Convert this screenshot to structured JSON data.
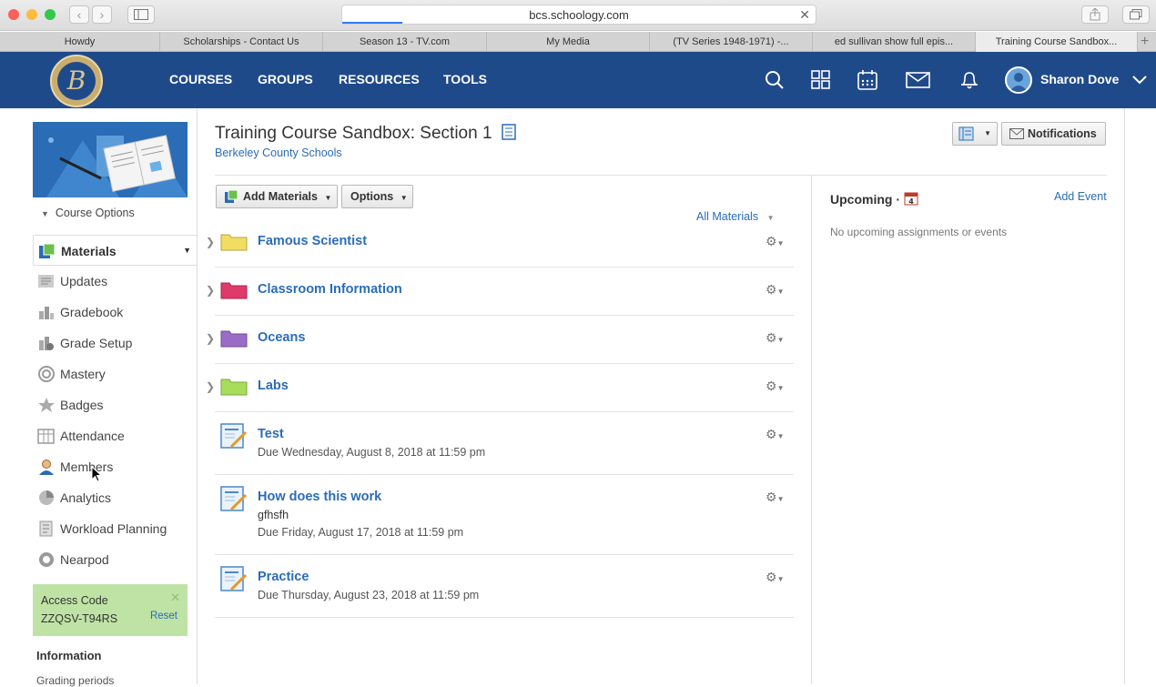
{
  "browser": {
    "url": "bcs.schoology.com",
    "tabs": [
      "Howdy",
      "Scholarships - Contact Us",
      "Season 13 - TV.com",
      "My Media",
      "(TV Series 1948-1971) -...",
      "ed sullivan show full epis...",
      "Training Course Sandbox..."
    ],
    "active_tab": 6
  },
  "nav": {
    "logo_letter": "B",
    "links": [
      "COURSES",
      "GROUPS",
      "RESOURCES",
      "TOOLS"
    ],
    "user_name": "Sharon Dove"
  },
  "sidebar": {
    "course_options": "Course Options",
    "items": [
      {
        "label": "Materials",
        "icon": "materials-icon"
      },
      {
        "label": "Updates",
        "icon": "updates-icon"
      },
      {
        "label": "Gradebook",
        "icon": "gradebook-icon"
      },
      {
        "label": "Grade Setup",
        "icon": "grade-setup-icon"
      },
      {
        "label": "Mastery",
        "icon": "mastery-icon"
      },
      {
        "label": "Badges",
        "icon": "badges-icon"
      },
      {
        "label": "Attendance",
        "icon": "attendance-icon"
      },
      {
        "label": "Members",
        "icon": "members-icon"
      },
      {
        "label": "Analytics",
        "icon": "analytics-icon"
      },
      {
        "label": "Workload Planning",
        "icon": "workload-icon"
      },
      {
        "label": "Nearpod",
        "icon": "nearpod-icon"
      }
    ],
    "access_code_label": "Access Code",
    "access_code": "ZZQSV-T94RS",
    "reset": "Reset",
    "info_heading": "Information",
    "grading_periods": "Grading periods"
  },
  "course": {
    "title": "Training Course Sandbox: Section 1",
    "school": "Berkeley County Schools",
    "notifications": "Notifications",
    "add_materials": "Add Materials",
    "options": "Options",
    "all_materials": "All Materials"
  },
  "materials": [
    {
      "type": "folder",
      "title": "Famous Scientist",
      "color": "#f2dd63"
    },
    {
      "type": "folder",
      "title": "Classroom Information",
      "color": "#e03a6a"
    },
    {
      "type": "folder",
      "title": "Oceans",
      "color": "#9b6cc6"
    },
    {
      "type": "folder",
      "title": "Labs",
      "color": "#a7dd5b"
    },
    {
      "type": "assignment",
      "title": "Test",
      "desc": "",
      "due": "Due Wednesday, August 8, 2018 at 11:59 pm"
    },
    {
      "type": "assignment",
      "title": "How does this work",
      "desc": "gfhsfh",
      "due": "Due Friday, August 17, 2018 at 11:59 pm"
    },
    {
      "type": "assignment",
      "title": "Practice",
      "desc": "",
      "due": "Due Thursday, August 23, 2018 at 11:59 pm"
    }
  ],
  "upcoming": {
    "title": "Upcoming",
    "add_event": "Add Event",
    "empty": "No upcoming assignments or events"
  }
}
